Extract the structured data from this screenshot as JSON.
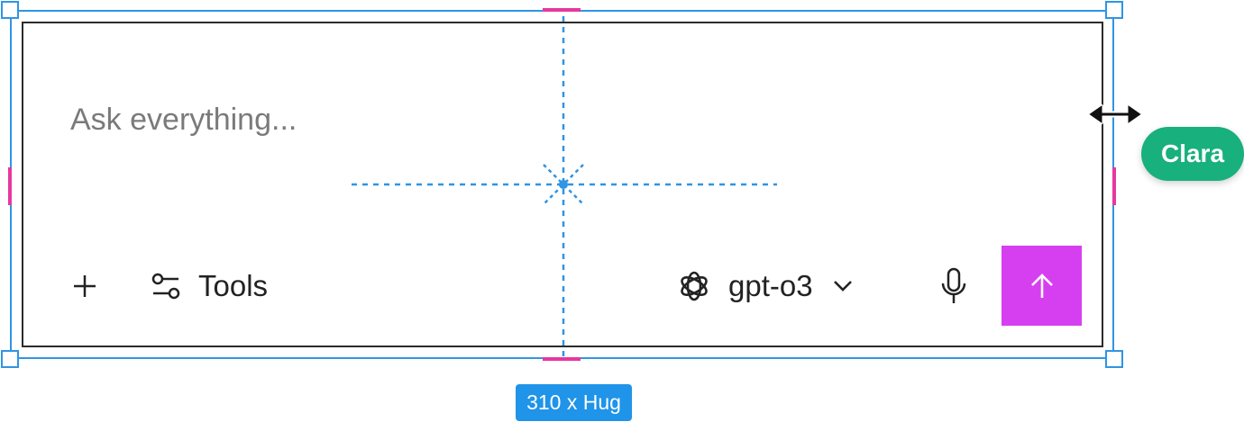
{
  "prompt": {
    "placeholder": "Ask everything...",
    "value": ""
  },
  "toolbar": {
    "add_icon": "plus-icon",
    "tools_icon": "sliders-icon",
    "tools_label": "Tools",
    "model_icon": "openai-logo-icon",
    "model_label": "gpt-o3",
    "model_dropdown_icon": "chevron-down-icon",
    "mic_icon": "microphone-icon",
    "send_icon": "arrow-up-icon"
  },
  "canvas": {
    "collaborator_name": "Clara",
    "size_label": "310 x Hug",
    "resize_cursor_icon": "horizontal-resize-cursor-icon"
  },
  "colors": {
    "selection": "#2f95e4",
    "midpoint_marks": "#e6389e",
    "send_button": "#d63ff0",
    "collaborator": "#18b07c",
    "size_label_bg": "#1f94e8",
    "border": "#2b2b2b"
  }
}
